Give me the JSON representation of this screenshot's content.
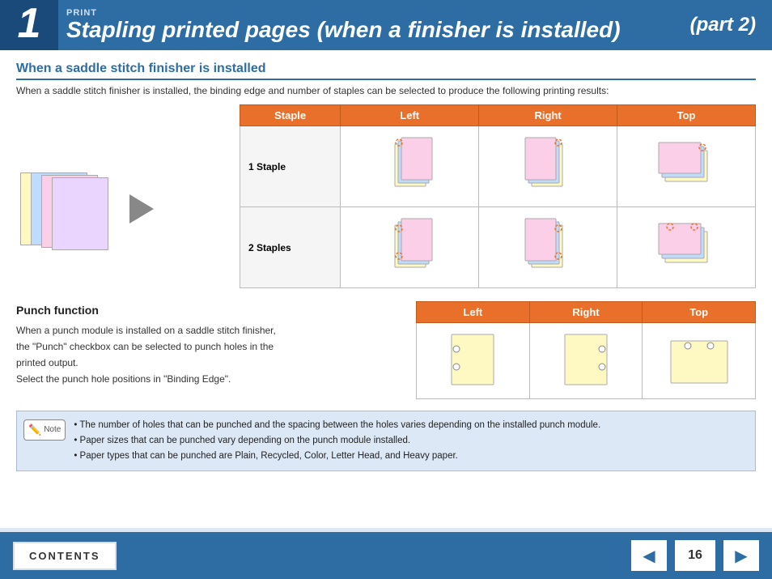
{
  "header": {
    "number": "1",
    "print_label": "PRINT",
    "title": "Stapling printed pages (when a finisher is installed)",
    "part": "(part 2)"
  },
  "section1": {
    "title": "When a saddle stitch finisher is installed",
    "intro": "When a saddle stitch finisher is installed, the binding edge and number of staples can be selected to produce the following printing results:"
  },
  "staple_table": {
    "headers": [
      "Staple",
      "Left",
      "Right",
      "Top"
    ],
    "rows": [
      {
        "label": "1 Staple"
      },
      {
        "label": "2 Staples"
      }
    ]
  },
  "punch_section": {
    "title": "Punch function",
    "text_lines": [
      "When a punch module is installed on a saddle stitch finisher,",
      "the \"Punch\" checkbox can be selected to punch holes in the",
      "printed output.",
      "Select the punch hole positions in \"Binding Edge\"."
    ],
    "table_headers": [
      "Left",
      "Right",
      "Top"
    ]
  },
  "note": {
    "icon_label": "Note",
    "bullets": [
      "The number of holes that can be punched and the spacing between the holes varies depending on the installed punch module.",
      "Paper sizes that can be punched vary depending on the punch module installed.",
      "Paper types that can be punched are Plain, Recycled, Color, Letter Head, and Heavy paper."
    ]
  },
  "footer": {
    "contents_label": "CONTENTS",
    "page_number": "16"
  }
}
